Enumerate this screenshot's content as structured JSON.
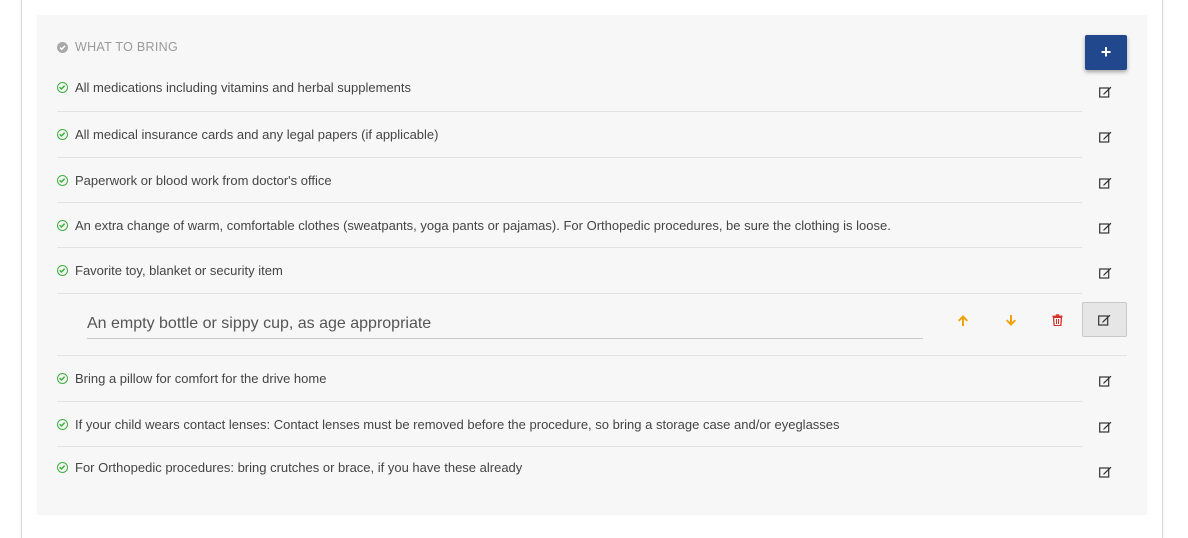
{
  "section": {
    "title": "WHAT TO BRING",
    "add_label": "+"
  },
  "items": [
    {
      "label": "All medications including vitamins and herbal supplements"
    },
    {
      "label": "All medical insurance cards and any legal papers (if applicable)"
    },
    {
      "label": "Paperwork or blood work from doctor's office"
    },
    {
      "label": "An extra change of warm, comfortable clothes (sweatpants, yoga pants or pajamas). For Orthopedic procedures, be sure the clothing is loose."
    },
    {
      "label": "Favorite toy, blanket or security item"
    },
    {
      "label": "An empty bottle or sippy cup, as age appropriate",
      "editing": true
    },
    {
      "label": "Bring a pillow for comfort for the drive home"
    },
    {
      "label": "If your child wears contact lenses: Contact lenses must be removed before the procedure, so bring a storage case and/or eyeglasses"
    },
    {
      "label": "For Orthopedic procedures: bring crutches or brace, if you have these already"
    }
  ],
  "editing": {
    "value": "An empty bottle or sippy cup, as age appropriate"
  },
  "icons": {
    "check": "check-circle-icon",
    "edit": "edit-icon",
    "up": "arrow-up-icon",
    "down": "arrow-down-icon",
    "delete": "trash-icon",
    "add": "plus-icon"
  },
  "colors": {
    "accent": "#21478d",
    "check": "#3fae3f",
    "arrow": "#f0a20a",
    "delete": "#d9302c"
  }
}
